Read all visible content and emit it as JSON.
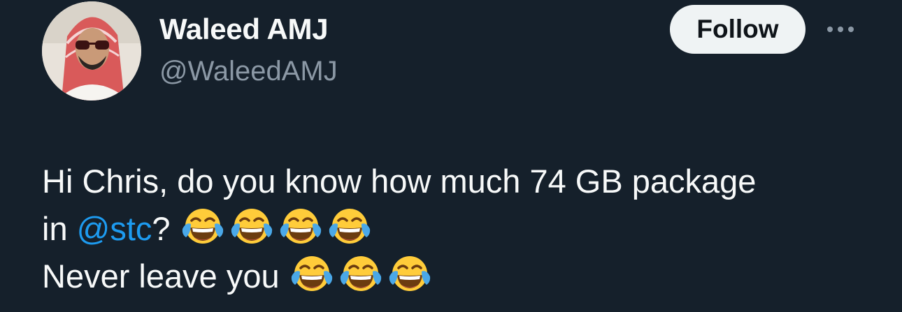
{
  "author": {
    "display_name": "Waleed AMJ",
    "handle": "@WaleedAMJ"
  },
  "actions": {
    "follow_label": "Follow"
  },
  "tweet": {
    "line1": "Hi Chris, do you know how much 74 GB package",
    "line2_prefix": "in ",
    "mention": "@stc",
    "line2_suffix": "?",
    "line3": "Never leave you",
    "emoji_name": "face-with-tears-of-joy",
    "line2_emoji_count": 4,
    "line3_emoji_count": 3
  },
  "colors": {
    "background": "#15202b",
    "text_primary": "#f7f9f9",
    "text_secondary": "#8b98a5",
    "link": "#1d9bf0",
    "follow_bg": "#eff3f4"
  }
}
